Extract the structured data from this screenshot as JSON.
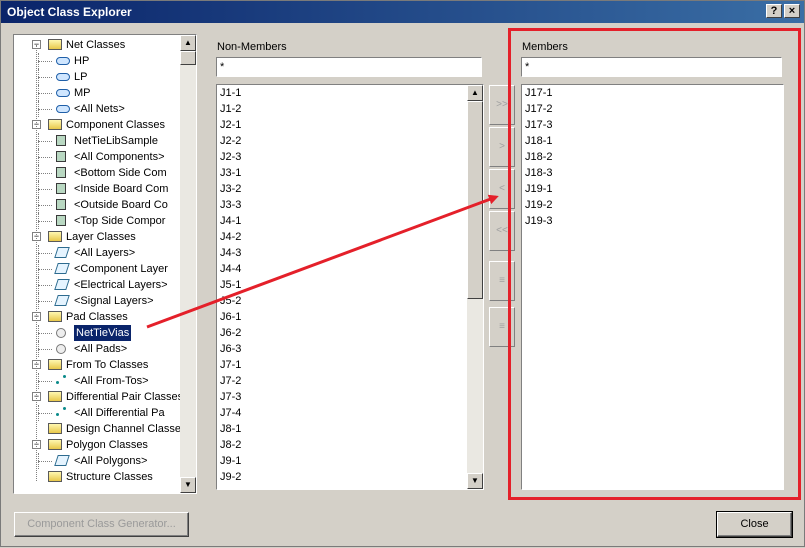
{
  "window": {
    "title": "Object Class Explorer",
    "help_label": "?",
    "close_label": "×"
  },
  "tree": {
    "items": [
      {
        "label": "Net Classes",
        "icon": "folder-icon",
        "level": 0,
        "expander": "−"
      },
      {
        "label": "HP",
        "icon": "net-class-icon",
        "level": 1
      },
      {
        "label": "LP",
        "icon": "net-class-icon",
        "level": 1
      },
      {
        "label": "MP",
        "icon": "net-class-icon",
        "level": 1
      },
      {
        "label": "<All Nets>",
        "icon": "net-class-icon",
        "level": 1
      },
      {
        "label": "Component Classes",
        "icon": "folder-icon",
        "level": 0,
        "expander": "−"
      },
      {
        "label": "NetTieLibSample",
        "icon": "component-class-icon",
        "level": 1
      },
      {
        "label": "<All Components>",
        "icon": "component-class-icon",
        "level": 1
      },
      {
        "label": "<Bottom Side Com",
        "icon": "component-class-icon",
        "level": 1
      },
      {
        "label": "<Inside Board Com",
        "icon": "component-class-icon",
        "level": 1
      },
      {
        "label": "<Outside Board Co",
        "icon": "component-class-icon",
        "level": 1
      },
      {
        "label": "<Top Side Compor",
        "icon": "component-class-icon",
        "level": 1
      },
      {
        "label": "Layer Classes",
        "icon": "folder-icon",
        "level": 0,
        "expander": "−"
      },
      {
        "label": "<All Layers>",
        "icon": "layer-class-icon",
        "level": 1
      },
      {
        "label": "<Component Layer",
        "icon": "layer-class-icon",
        "level": 1
      },
      {
        "label": "<Electrical Layers>",
        "icon": "layer-class-icon",
        "level": 1
      },
      {
        "label": "<Signal Layers>",
        "icon": "layer-class-icon",
        "level": 1
      },
      {
        "label": "Pad Classes",
        "icon": "folder-icon",
        "level": 0,
        "expander": "−"
      },
      {
        "label": "NetTieVias",
        "icon": "pad-class-icon",
        "level": 1,
        "selected": true
      },
      {
        "label": "<All Pads>",
        "icon": "pad-class-icon",
        "level": 1
      },
      {
        "label": "From To Classes",
        "icon": "folder-icon",
        "level": 0,
        "expander": "−"
      },
      {
        "label": "<All From-Tos>",
        "icon": "from-to-icon",
        "level": 1
      },
      {
        "label": "Differential Pair Classes",
        "icon": "folder-icon",
        "level": 0,
        "expander": "−"
      },
      {
        "label": "<All Differential Pa",
        "icon": "from-to-icon",
        "level": 1
      },
      {
        "label": "Design Channel Classes",
        "icon": "folder-icon",
        "level": 0
      },
      {
        "label": "Polygon Classes",
        "icon": "folder-icon",
        "level": 0,
        "expander": "−"
      },
      {
        "label": "<All Polygons>",
        "icon": "polygon-class-icon",
        "level": 1
      },
      {
        "label": "Structure Classes",
        "icon": "folder-icon",
        "level": 0
      }
    ]
  },
  "non_members": {
    "label": "Non-Members",
    "filter_value": "*",
    "items": [
      "J1-1",
      "J1-2",
      "J2-1",
      "J2-2",
      "J2-3",
      "J3-1",
      "J3-2",
      "J3-3",
      "J4-1",
      "J4-2",
      "J4-3",
      "J4-4",
      "J5-1",
      "J5-2",
      "J6-1",
      "J6-2",
      "J6-3",
      "J7-1",
      "J7-2",
      "J7-3",
      "J7-4",
      "J8-1",
      "J8-2",
      "J9-1",
      "J9-2"
    ]
  },
  "members": {
    "label": "Members",
    "filter_value": "*",
    "items": [
      "J17-1",
      "J17-2",
      "J17-3",
      "J18-1",
      "J18-2",
      "J18-3",
      "J19-1",
      "J19-2",
      "J19-3"
    ]
  },
  "transfer_buttons": [
    {
      "name": "add-all-button",
      "label": ">>"
    },
    {
      "name": "add-selected-button",
      "label": ">"
    },
    {
      "name": "remove-selected-button",
      "label": "<"
    },
    {
      "name": "remove-all-button",
      "label": "<<"
    },
    {
      "name": "move-up-button",
      "label": "≡"
    },
    {
      "name": "move-down-button",
      "label": "≡"
    }
  ],
  "footer": {
    "generator_label": "Component Class Generator...",
    "close_label": "Close"
  },
  "annotation": {
    "color": "#e4202a"
  }
}
